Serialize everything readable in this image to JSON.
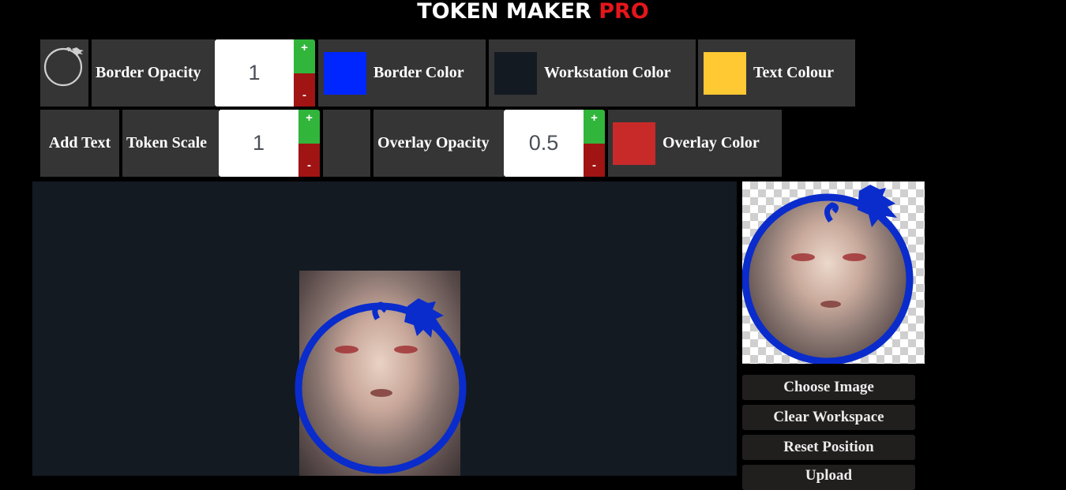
{
  "header": {
    "title_main": "TOKEN MAKER",
    "title_accent": "PRO"
  },
  "toolbar_row1": {
    "border_thumbnail_icon": "ring-with-scorpion-icon",
    "border_opacity": {
      "label": "Border Opacity",
      "value": "1",
      "plus": "+",
      "minus": "-"
    },
    "border_color": {
      "label": "Border Color",
      "color": "#0026ff"
    },
    "workstation_color": {
      "label": "Workstation Color",
      "color": "#131a22"
    },
    "text_colour": {
      "label": "Text Colour",
      "color": "#ffc933"
    }
  },
  "toolbar_row2": {
    "add_text": {
      "label": "Add Text"
    },
    "token_scale": {
      "label": "Token Scale",
      "value": "1",
      "plus": "+",
      "minus": "-"
    },
    "overlay_opacity": {
      "label": "Overlay Opacity",
      "value": "0.5",
      "plus": "+",
      "minus": "-"
    },
    "overlay_color": {
      "label": "Overlay Color",
      "color": "#c82a2a"
    }
  },
  "colors": {
    "tile_bg": "#353535",
    "plus_green": "#31b53b",
    "minus_red": "#a01414",
    "ring_blue": "#0a2ccc",
    "title_red": "#e5161b"
  },
  "sidebar": {
    "buttons": [
      {
        "label": "Choose Image"
      },
      {
        "label": "Clear Workspace"
      },
      {
        "label": "Reset Position"
      },
      {
        "label": "Upload"
      }
    ]
  }
}
